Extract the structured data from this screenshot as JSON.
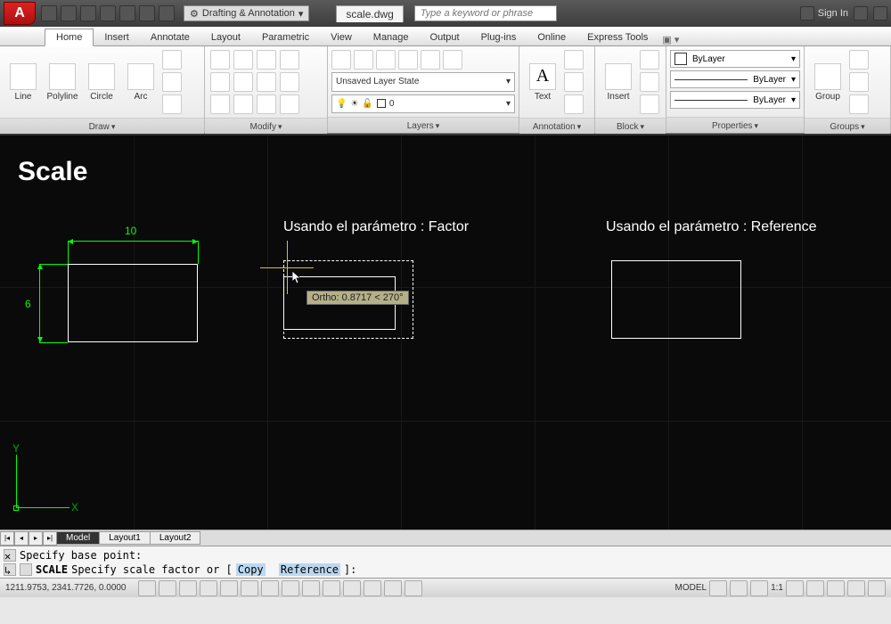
{
  "titlebar": {
    "workspace": "Drafting & Annotation",
    "filename": "scale.dwg",
    "search_placeholder": "Type a keyword or phrase",
    "signin": "Sign In"
  },
  "ribbon": {
    "tabs": [
      "Home",
      "Insert",
      "Annotate",
      "Layout",
      "Parametric",
      "View",
      "Manage",
      "Output",
      "Plug-ins",
      "Online",
      "Express Tools"
    ],
    "active_tab": "Home",
    "draw": {
      "title": "Draw",
      "tools": {
        "line": "Line",
        "polyline": "Polyline",
        "circle": "Circle",
        "arc": "Arc"
      }
    },
    "modify": {
      "title": "Modify"
    },
    "layers": {
      "title": "Layers",
      "state": "Unsaved Layer State",
      "current": "0"
    },
    "annotation": {
      "title": "Annotation",
      "text": "Text"
    },
    "block": {
      "title": "Block",
      "insert": "Insert"
    },
    "properties": {
      "title": "Properties",
      "color": "ByLayer",
      "lineweight": "ByLayer",
      "linetype": "ByLayer"
    },
    "groups": {
      "title": "Groups",
      "group": "Group"
    }
  },
  "canvas": {
    "title": "Scale",
    "label_factor": "Usando el parámetro : Factor",
    "label_reference": "Usando el parámetro : Reference",
    "dim_width": "10",
    "dim_height": "6",
    "tooltip": "Ortho: 0.8717 < 270°",
    "ucs": {
      "x": "X",
      "y": "Y"
    }
  },
  "sheets": {
    "tabs": [
      "Model",
      "Layout1",
      "Layout2"
    ],
    "active": "Model"
  },
  "command": {
    "history": "Specify base point:",
    "prompt_cmd": "SCALE",
    "prompt_text": "Specify scale factor or [",
    "opt1": "Copy",
    "opt2": "Reference",
    "prompt_end": "]:"
  },
  "status": {
    "coords": "1211.9753, 2341.7726, 0.0000",
    "model": "MODEL",
    "scale": "1:1"
  }
}
